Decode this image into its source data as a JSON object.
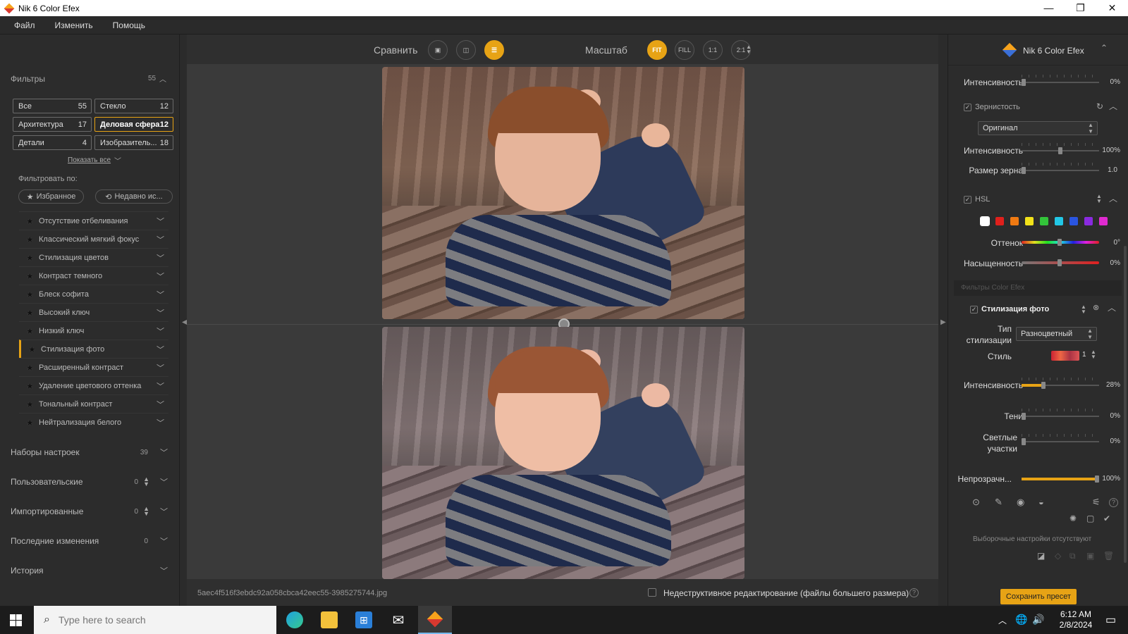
{
  "window": {
    "title": "Nik 6 Color Efex",
    "minimize": "—",
    "restore": "❐",
    "close": "✕"
  },
  "menu": [
    "Файл",
    "Изменить",
    "Помощь"
  ],
  "left": {
    "filters_title": "Фильтры",
    "filters_count": "55",
    "categories": [
      {
        "label": "Все",
        "count": "55"
      },
      {
        "label": "Стекло",
        "count": "12"
      },
      {
        "label": "Архитектура",
        "count": "17"
      },
      {
        "label": "Деловая сфера",
        "count": "12"
      },
      {
        "label": "Детали",
        "count": "4"
      },
      {
        "label": "Изобразитель...",
        "count": "18"
      }
    ],
    "show_all": "Показать все",
    "filter_by": "Фильтровать по:",
    "favorites": "Избранное",
    "recent": "Недавно ис...",
    "filters": [
      "Отсутствие отбеливания",
      "Классический мягкий фокус",
      "Стилизация цветов",
      "Контраст темного",
      "Блеск софита",
      "Высокий ключ",
      "Низкий ключ",
      "Стилизация фото",
      "Расширенный контраст",
      "Удаление цветового оттенка",
      "Тональный контраст",
      "Нейтрализация белого"
    ],
    "selected_filter": "Стилизация фото",
    "groups": [
      {
        "label": "Наборы настроек",
        "count": "39"
      },
      {
        "label": "Пользовательские",
        "count": "0"
      },
      {
        "label": "Импортированные",
        "count": "0"
      },
      {
        "label": "Последние изменения",
        "count": "0"
      },
      {
        "label": "История",
        "count": ""
      }
    ]
  },
  "toolbar": {
    "compare_label": "Сравнить",
    "zoom_label": "Масштаб",
    "fit": "FIT",
    "fill": "FILL",
    "one_one": "1:1",
    "two_one": "2:1"
  },
  "status": {
    "filename": "5aec4f516f3ebdc92a058cbca42eec55-3985275744.jpg",
    "nondestructive": "Недеструктивное редактирование (файлы большего размера)",
    "help": "?"
  },
  "right": {
    "title": "Nik 6 Color Efex",
    "intensity_label": "Интенсивность",
    "intensity_top": "0%",
    "grain_title": "Зернистость",
    "grain_mode": "Оригинал",
    "grain_intensity": "100%",
    "grain_size_label": "Размер зерна",
    "grain_size": "1.0",
    "hsl_title": "HSL",
    "hsl_colors": [
      "#ffffff",
      "#e0201c",
      "#f07a12",
      "#f2e21a",
      "#33c43a",
      "#22c7e6",
      "#2a55e0",
      "#8a2ae0",
      "#e02ad0"
    ],
    "hue_label": "Оттенок",
    "hue_value": "0°",
    "sat_label": "Насыщенность",
    "sat_value": "0%",
    "color_efex_filters": "Фильтры Color Efex",
    "photo_style_title": "Стилизация фото",
    "style_type_label": "Тип стилизации",
    "style_type_value": "Разноцветный",
    "style_label": "Стиль",
    "style_value": "1",
    "style_intensity": "28%",
    "style_intensity_frac": 0.28,
    "shadows_label": "Тени",
    "shadows_value": "0%",
    "highlights_label": "Светлые участки",
    "highlights_value": "0%",
    "opacity_label": "Непрозрачн...",
    "opacity_value": "100%",
    "no_selective": "Выборочные настройки отсутствуют",
    "save_preset": "Сохранить пресет"
  },
  "taskbar": {
    "search_placeholder": "Type here to search",
    "time": "6:12 AM",
    "date": "2/8/2024"
  }
}
